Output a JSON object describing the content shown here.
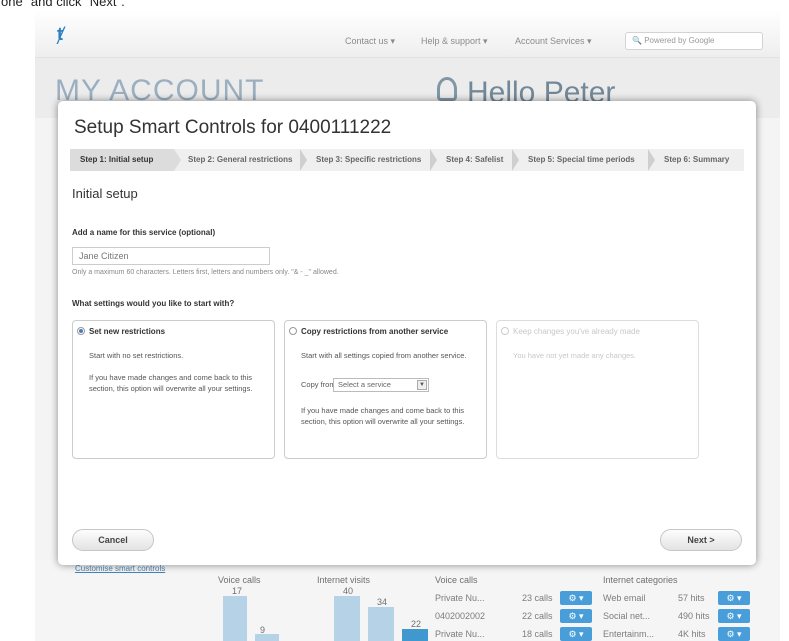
{
  "caption": "one\" and click \"Next\".",
  "background": {
    "nav": [
      "Contact us",
      "Help & support",
      "Account Services"
    ],
    "search_placeholder": "Powered by Google",
    "title": "MY ACCOUNT",
    "greeting": "Hello Peter",
    "link": "Customise smart controls",
    "voice_title": "Voice calls",
    "voice_bars": [
      "17",
      "9"
    ],
    "internet_title": "Internet visits",
    "internet_bars": [
      "40",
      "34",
      "22"
    ],
    "calls_title": "Voice calls",
    "calls": [
      {
        "name": "Private Nu...",
        "count": "23 calls"
      },
      {
        "name": "0402002002",
        "count": "22 calls"
      },
      {
        "name": "Private Nu...",
        "count": "18 calls"
      }
    ],
    "categories_title": "Internet categories",
    "categories": [
      {
        "name": "Web email",
        "count": "57 hits"
      },
      {
        "name": "Social net...",
        "count": "490 hits"
      },
      {
        "name": "Entertainm...",
        "count": "4K hits"
      }
    ]
  },
  "modal": {
    "title": "Setup Smart Controls for 0400111222",
    "steps": [
      "Step 1: Initial setup",
      "Step 2: General restrictions",
      "Step 3: Specific restrictions",
      "Step 4: Safelist",
      "Step 5: Special time periods",
      "Step 6: Summary"
    ],
    "section_title": "Initial setup",
    "name_label": "Add a name for this service (optional)",
    "name_value": "Jane Citizen",
    "name_hint": "Only a maximum 60 characters. Letters first, letters and numbers only. \"& - _\" allowed.",
    "settings_question": "What settings would you like to start with?",
    "options": {
      "new": {
        "title": "Set new restrictions",
        "line1": "Start with no set restrictions.",
        "line2": "If you have made changes and come back to this section, this option will overwrite all your settings."
      },
      "copy": {
        "title": "Copy restrictions from another service",
        "line1": "Start with all settings copied from another service.",
        "copy_from": "Copy from",
        "select_value": "Select a service",
        "line2": "If you have made changes and come back to this section, this option will overwrite all your settings."
      },
      "keep": {
        "title": "Keep changes you've already made",
        "line1": "You have not yet made any changes."
      }
    },
    "cancel_label": "Cancel",
    "next_label": "Next >"
  }
}
